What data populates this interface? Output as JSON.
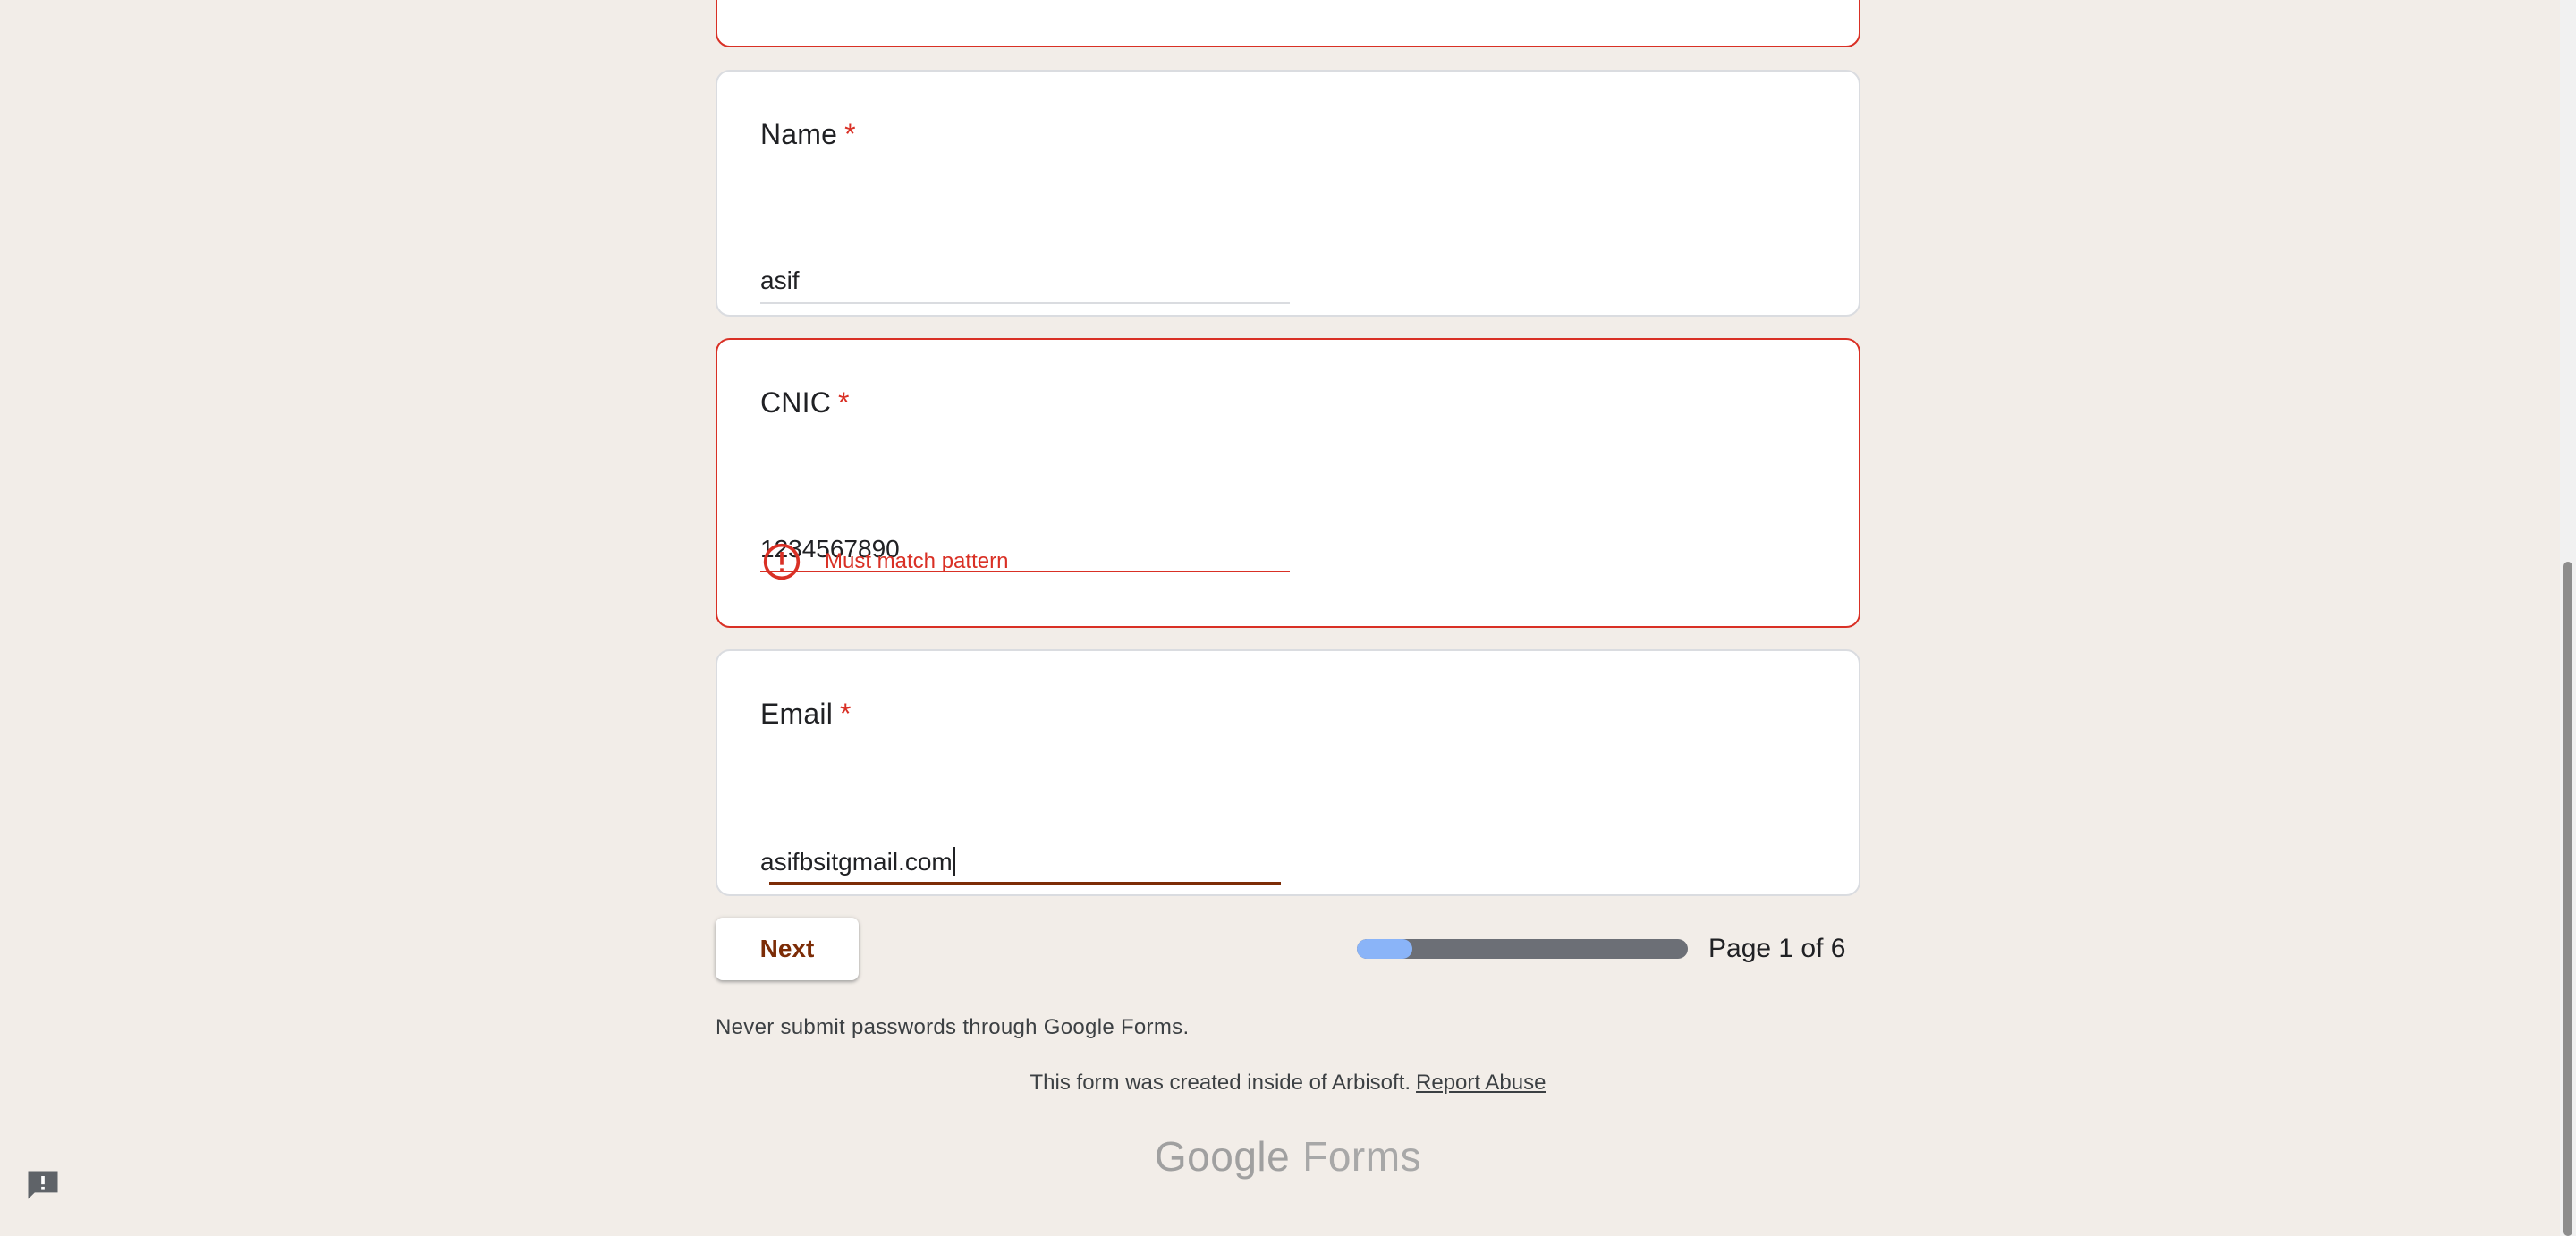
{
  "questions": [
    {
      "title": "Name",
      "required_mark": "*",
      "value": "asif"
    },
    {
      "title": "CNIC",
      "required_mark": "*",
      "value": "1234567890",
      "error": "Must match pattern"
    },
    {
      "title": "Email",
      "required_mark": "*",
      "value": "asifbsitgmail.com"
    }
  ],
  "nav": {
    "next_label": "Next",
    "progress_fraction": 0.167,
    "page_label": "Page 1 of 6"
  },
  "footer": {
    "password_note": "Never submit passwords through Google Forms.",
    "created_text": "This form was created inside of Arbisoft.",
    "report_link": "Report Abuse",
    "brand_google": "Google",
    "brand_forms": "Forms"
  },
  "icons": {
    "error": "error-circle-icon",
    "feedback": "feedback-icon"
  },
  "colors": {
    "background": "#f2ede8",
    "error": "#d93025",
    "accent": "#7c2c06",
    "progress_fill": "#8ab4f8",
    "progress_track": "#6c6f76"
  }
}
